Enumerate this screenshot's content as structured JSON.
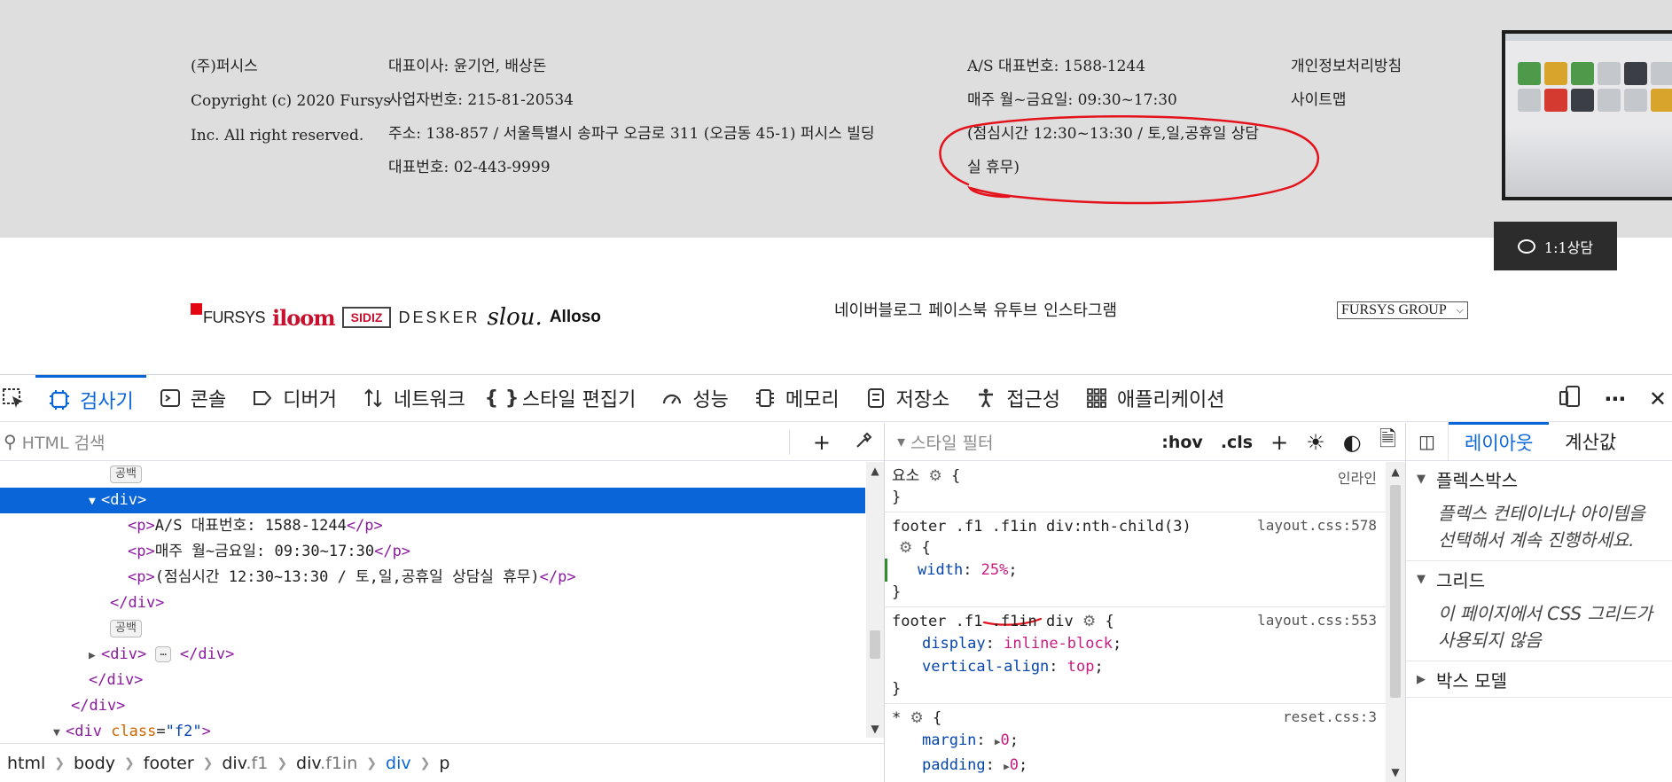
{
  "footer": {
    "col1": [
      "(주)퍼시스",
      "Copyright (c) 2020 Fursys",
      "Inc. All right reserved."
    ],
    "col2": [
      "대표이사: 윤기언, 배상돈",
      "사업자번호: 215-81-20534",
      "주소: 138-857 / 서울특별시 송파구 오금로 311 (오금동 45-1) 퍼시스 빌딩",
      "대표번호: 02-443-9999"
    ],
    "col3": [
      "A/S 대표번호: 1588-1244",
      "매주 월~금요일: 09:30~17:30",
      "(점심시간 12:30~13:30 / 토,일,공휴일 상담",
      "실 휴무)"
    ],
    "col4": [
      "개인정보처리방침",
      "사이트맵"
    ],
    "annotation_color": "#e3121b"
  },
  "chat_button": {
    "label": "1:1상담"
  },
  "brands": {
    "fursys": "FURSYS",
    "iloom": "iloom",
    "sidiz": "SIDIZ",
    "desker": "DESKER",
    "slou": "slou.",
    "alloso": "Alloso"
  },
  "social": [
    "네이버블로그",
    "페이스북",
    "유투브",
    "인스타그램"
  ],
  "group_select": {
    "value": "FURSYS GROUP"
  },
  "devtools": {
    "tabs": [
      "검사기",
      "콘솔",
      "디버거",
      "네트워크",
      "스타일 편집기",
      "성능",
      "메모리",
      "저장소",
      "접근성",
      "애플리케이션"
    ],
    "active_tab": "검사기",
    "html_search_placeholder": "HTML 검색",
    "tree": {
      "whitespace": "공백",
      "div_open": "<div>",
      "p_open": "<p>",
      "p_close": "</p>",
      "p1": "A/S 대표번호: 1588-1244",
      "p2": "매주 월~금요일: 09:30~17:30",
      "p3": "(점심시간 12:30~13:30 / 토,일,공휴일 상담실 휴무)",
      "div_close": "</div>",
      "collapsed_div_open": "<div>",
      "collapsed_div_close": "</div>",
      "ellipsis": "⋯",
      "f2_tag_open": "<div",
      "f2_attr": "class",
      "f2_value": "\"f2\"",
      "f2_tag_end": ">"
    },
    "breadcrumbs": [
      {
        "tag": "html",
        "cls": ""
      },
      {
        "tag": "body",
        "cls": ""
      },
      {
        "tag": "footer",
        "cls": ""
      },
      {
        "tag": "div",
        "cls": ".f1"
      },
      {
        "tag": "div",
        "cls": ".f1in"
      },
      {
        "tag": "div",
        "cls": ""
      },
      {
        "tag": "p",
        "cls": ""
      }
    ],
    "styles_filter_placeholder": "스타일 필터",
    "styles_buttons": {
      "hov": ":hov",
      "cls": ".cls"
    },
    "rules": [
      {
        "selector": "요소",
        "source": "인라인",
        "decls": []
      },
      {
        "selector": "footer .f1 .f1in div:nth-child(3)",
        "source": "layout.css:578",
        "decls": [
          {
            "prop": "width",
            "value": "25%"
          }
        ]
      },
      {
        "selector": "footer .f1 .f1in div",
        "source": "layout.css:553",
        "decls": [
          {
            "prop": "display",
            "value": "inline-block"
          },
          {
            "prop": "vertical-align",
            "value": "top"
          }
        ]
      },
      {
        "selector": "*",
        "source": "reset.css:3",
        "decls": [
          {
            "prop": "margin",
            "value": "0"
          },
          {
            "prop": "padding",
            "value": "0"
          }
        ]
      }
    ],
    "layout_tabs": [
      "레이아웃",
      "계산값"
    ],
    "layout_sections": [
      {
        "title": "플렉스박스",
        "text": [
          "플렉스 컨테이너나 아이템을",
          "선택해서 계속 진행하세요."
        ]
      },
      {
        "title": "그리드",
        "text": [
          "이 페이지에서 CSS 그리드가",
          "사용되지 않음"
        ]
      },
      {
        "title": "박스 모델",
        "text": []
      }
    ]
  }
}
